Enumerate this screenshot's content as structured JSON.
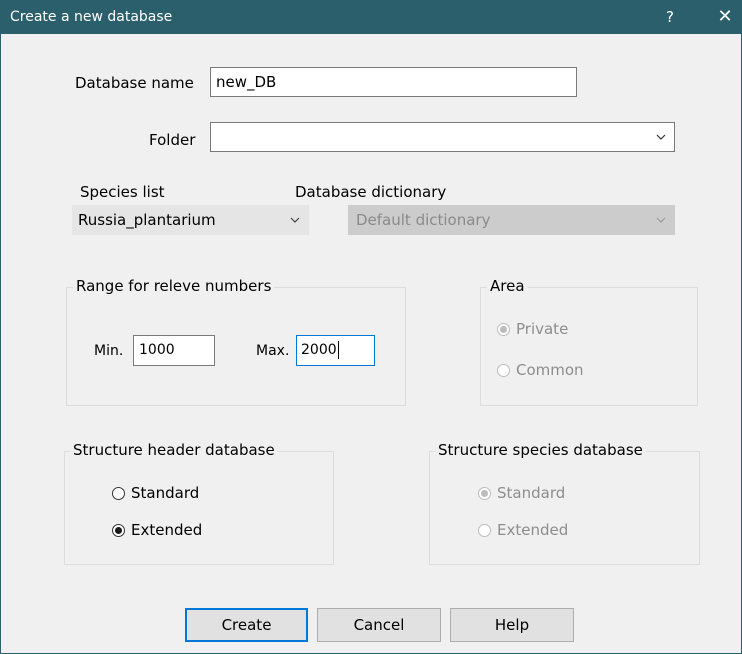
{
  "window": {
    "title": "Create a new database",
    "help_glyph": "?",
    "close_glyph": "✕"
  },
  "database_name": {
    "label": "Database name",
    "value": "new_DB"
  },
  "folder": {
    "label": "Folder",
    "value": ""
  },
  "species_list": {
    "label": "Species list",
    "value": "Russia_plantarium"
  },
  "database_dictionary": {
    "label": "Database dictionary",
    "value": "Default dictionary"
  },
  "range": {
    "title": "Range for releve numbers",
    "min_label": "Min.",
    "min_value": "1000",
    "max_label": "Max.",
    "max_value": "2000"
  },
  "area": {
    "title": "Area",
    "options": [
      {
        "label": "Private",
        "checked": true
      },
      {
        "label": "Common",
        "checked": false
      }
    ]
  },
  "structure_header": {
    "title": "Structure header database",
    "options": [
      {
        "label": "Standard",
        "checked": false
      },
      {
        "label": "Extended",
        "checked": true
      }
    ]
  },
  "structure_species": {
    "title": "Structure species database",
    "options": [
      {
        "label": "Standard",
        "checked": true
      },
      {
        "label": "Extended",
        "checked": false
      }
    ]
  },
  "buttons": {
    "create": "Create",
    "cancel": "Cancel",
    "help": "Help"
  },
  "colors": {
    "titlebar": "#2b5f6b",
    "accent": "#0078d7",
    "dialog_bg": "#f0f0f0"
  }
}
